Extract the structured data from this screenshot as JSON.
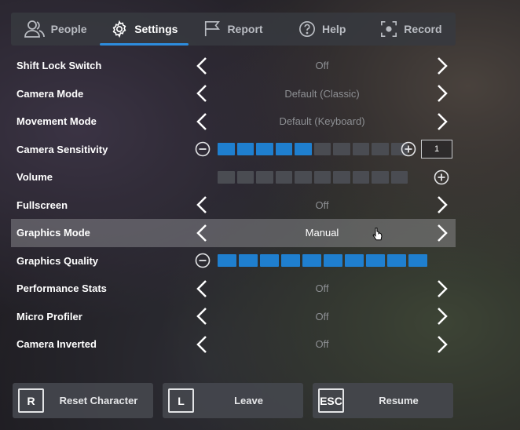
{
  "tabs": [
    {
      "label": "People",
      "icon": "people-icon",
      "active": false
    },
    {
      "label": "Settings",
      "icon": "gear-icon",
      "active": true
    },
    {
      "label": "Report",
      "icon": "flag-icon",
      "active": false
    },
    {
      "label": "Help",
      "icon": "help-icon",
      "active": false
    },
    {
      "label": "Record",
      "icon": "record-icon",
      "active": false
    }
  ],
  "settings": {
    "shift_lock": {
      "label": "Shift Lock Switch",
      "value": "Off"
    },
    "camera_mode": {
      "label": "Camera Mode",
      "value": "Default (Classic)"
    },
    "movement_mode": {
      "label": "Movement Mode",
      "value": "Default (Keyboard)"
    },
    "camera_sensitivity": {
      "label": "Camera Sensitivity",
      "level": 5,
      "segments": 10,
      "input_value": "1"
    },
    "volume": {
      "label": "Volume",
      "level": 0,
      "segments": 10
    },
    "fullscreen": {
      "label": "Fullscreen",
      "value": "Off"
    },
    "graphics_mode": {
      "label": "Graphics Mode",
      "value": "Manual"
    },
    "graphics_quality": {
      "label": "Graphics Quality",
      "level": 10,
      "segments": 10
    },
    "performance_stats": {
      "label": "Performance Stats",
      "value": "Off"
    },
    "micro_profiler": {
      "label": "Micro Profiler",
      "value": "Off"
    },
    "camera_inverted": {
      "label": "Camera Inverted",
      "value": "Off"
    }
  },
  "buttons": {
    "reset": {
      "key": "R",
      "label": "Reset Character"
    },
    "leave": {
      "key": "L",
      "label": "Leave"
    },
    "resume": {
      "key": "ESC",
      "label": "Resume"
    }
  },
  "colors": {
    "accent": "#2d8cdd",
    "bar_on": "#1f7fcf",
    "bar_off": "#4a4c52",
    "highlight_row": "#96969b"
  }
}
